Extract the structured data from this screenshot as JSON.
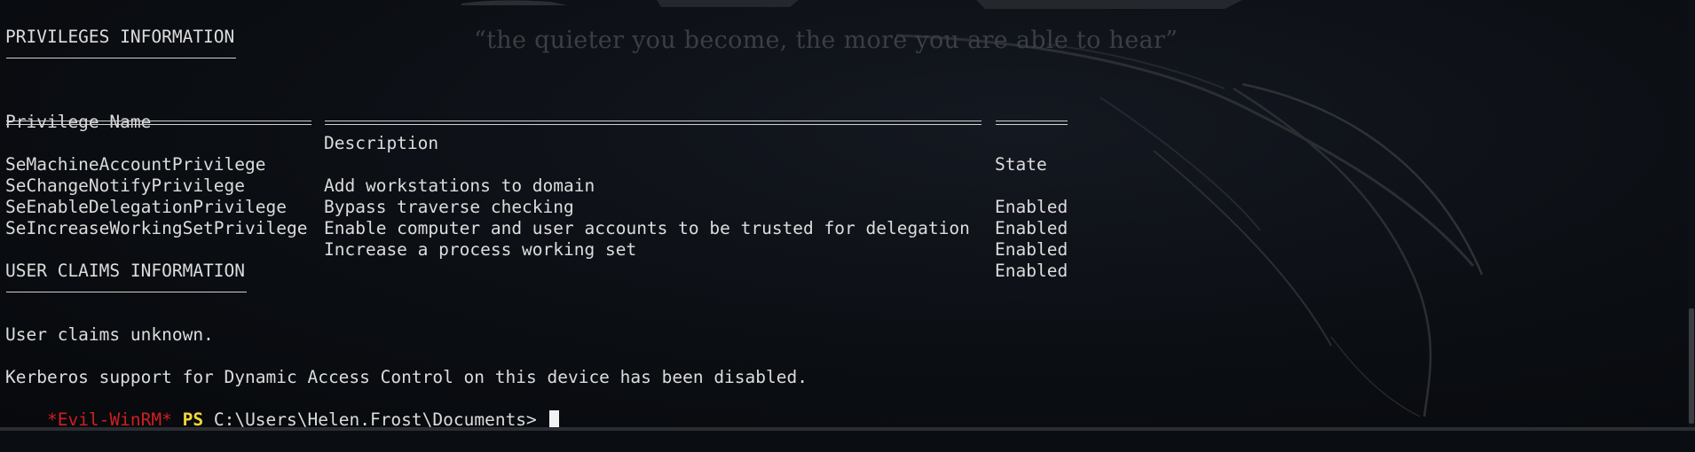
{
  "wallpaper": {
    "motto": "“the quieter you become, the more you are able to hear”"
  },
  "privileges": {
    "heading": "PRIVILEGES INFORMATION",
    "columns": {
      "name": "Privilege Name",
      "description": "Description",
      "state": "State"
    },
    "rows": [
      {
        "name": "SeMachineAccountPrivilege",
        "description": "Add workstations to domain",
        "state": "Enabled"
      },
      {
        "name": "SeChangeNotifyPrivilege",
        "description": "Bypass traverse checking",
        "state": "Enabled"
      },
      {
        "name": "SeEnableDelegationPrivilege",
        "description": "Enable computer and user accounts to be trusted for delegation",
        "state": "Enabled"
      },
      {
        "name": "SeIncreaseWorkingSetPrivilege",
        "description": "Increase a process working set",
        "state": "Enabled"
      }
    ]
  },
  "claims": {
    "heading": "USER CLAIMS INFORMATION",
    "message": "User claims unknown."
  },
  "kerberos_message": "Kerberos support for Dynamic Access Control on this device has been disabled.",
  "prompt": {
    "tag": "*Evil-WinRM*",
    "shell": "PS",
    "path": "C:\\Users\\Helen.Frost\\Documents>"
  },
  "colors": {
    "background": "#0a0d12",
    "text": "#dcdcdc",
    "prompt_tag": "#d11f1f",
    "prompt_shell": "#f2d63b"
  }
}
